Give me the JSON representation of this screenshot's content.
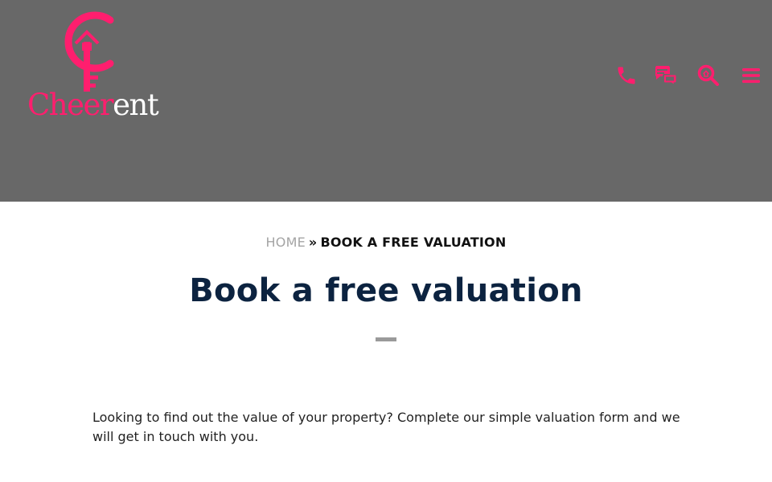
{
  "header": {
    "background": "#686868",
    "accent": "#ff1e6e",
    "logo": {
      "text_part1": "Cheer",
      "text_part2": "ent"
    },
    "icons": [
      {
        "name": "phone-icon"
      },
      {
        "name": "chat-icon"
      },
      {
        "name": "search-icon"
      },
      {
        "name": "menu-icon"
      }
    ]
  },
  "breadcrumb": {
    "home": "HOME",
    "separator": "»",
    "current": "BOOK A FREE VALUATION"
  },
  "main": {
    "title": "Book a free valuation",
    "title_color": "#0c2340",
    "intro": "Looking to find out the value of your property? Complete our simple valuation form and we will get in touch with you."
  }
}
